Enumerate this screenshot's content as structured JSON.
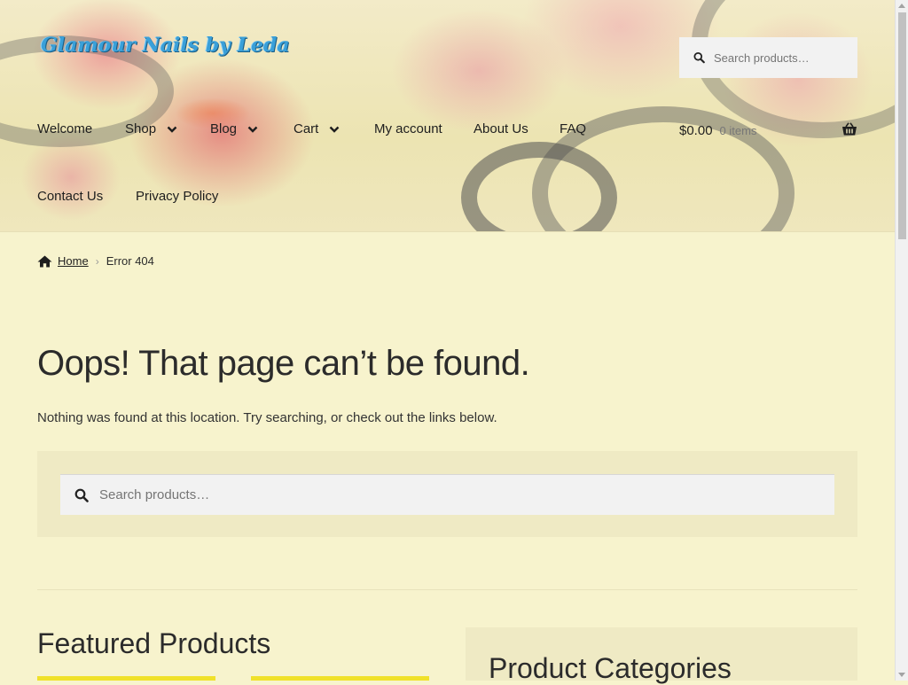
{
  "site": {
    "title": "Glamour Nails by Leda"
  },
  "header_search": {
    "placeholder": "Search products…"
  },
  "nav": {
    "items": [
      {
        "label": "Welcome"
      },
      {
        "label": "Shop"
      },
      {
        "label": "Blog"
      },
      {
        "label": "Cart"
      },
      {
        "label": "My account"
      },
      {
        "label": "About Us"
      },
      {
        "label": "FAQ"
      },
      {
        "label": "Contact Us"
      },
      {
        "label": "Privacy Policy"
      }
    ]
  },
  "cart": {
    "amount": "$0.00",
    "count": "0 items"
  },
  "breadcrumb": {
    "home": "Home",
    "current": "Error 404"
  },
  "main": {
    "title": "Oops! That page can’t be found.",
    "intro": "Nothing was found at this location. Try searching, or check out the links below.",
    "search_placeholder": "Search products…"
  },
  "featured": {
    "title": "Featured Products"
  },
  "categories": {
    "title": "Product Categories"
  },
  "colors": {
    "background": "#f7f3cd",
    "panel": "#efeac4",
    "product_accent": "#f0e12a",
    "title_blue": "#3aa0d9"
  }
}
